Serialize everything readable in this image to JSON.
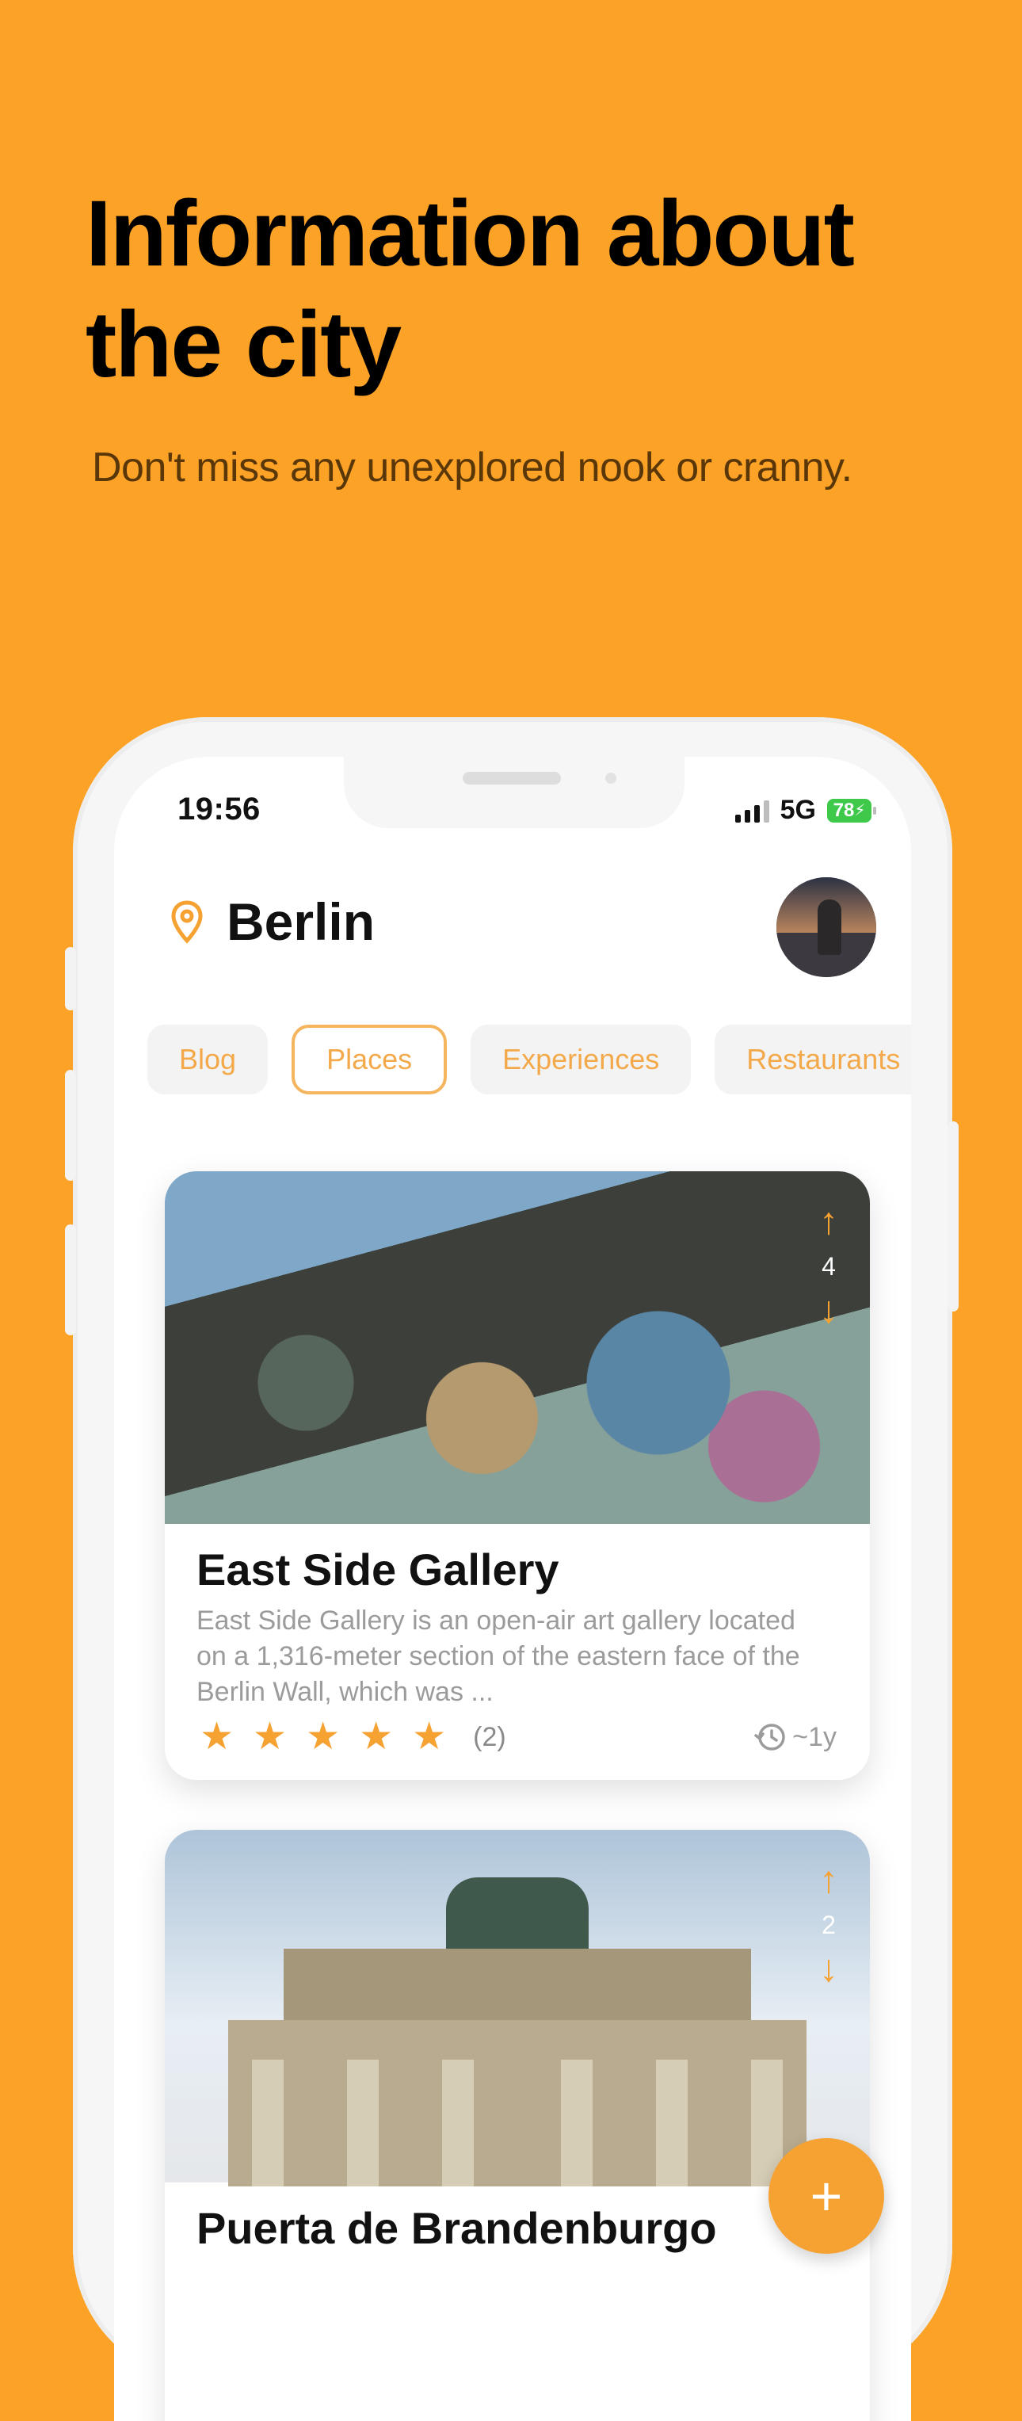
{
  "promo": {
    "headline": "Information about the city",
    "subhead": "Don't miss any unexplored nook or cranny."
  },
  "status_bar": {
    "time": "19:56",
    "network": "5G",
    "battery": "78"
  },
  "header": {
    "city": "Berlin",
    "location_icon": "map-pin-icon",
    "avatar": "profile-avatar"
  },
  "tabs": [
    {
      "label": "Blog",
      "active": false
    },
    {
      "label": "Places",
      "active": true
    },
    {
      "label": "Experiences",
      "active": false
    },
    {
      "label": "Restaurants",
      "active": false
    }
  ],
  "places": [
    {
      "title": "East Side Gallery",
      "description": "East Side Gallery is an open-air art gallery located on a 1,316-meter section of the eastern face of the Berlin Wall, which was ...",
      "votes": "4",
      "rating": 5,
      "reviews": "(2)",
      "age": "~1y"
    },
    {
      "title": "Puerta de Brandenburgo",
      "votes": "2"
    }
  ],
  "fab": {
    "label": "+"
  },
  "colors": {
    "accent": "#FCA226",
    "star": "#f6a233",
    "tab_text": "#f3a94a"
  }
}
